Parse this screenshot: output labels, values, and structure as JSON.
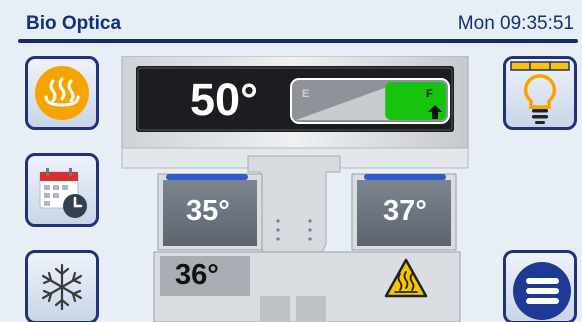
{
  "header": {
    "brand": "Bio Optica",
    "datetime": "Mon 09:35:51",
    "accent_color": "#13307a"
  },
  "sidebar_left": [
    {
      "icon": "heat-waves-icon"
    },
    {
      "icon": "calendar-clock-icon"
    },
    {
      "icon": "snowflake-icon"
    }
  ],
  "sidebar_right": [
    {
      "icon": "lightbulb-icon"
    },
    {
      "icon": "menu-icon"
    }
  ],
  "instrument": {
    "main_temp": "50°",
    "left_tank_temp": "35°",
    "right_tank_temp": "37°",
    "bottom_tank_temp": "36°",
    "level_gauge": {
      "empty_label": "E",
      "full_label": "F",
      "fill_fraction": 0.4,
      "fill_color": "#16c40f"
    },
    "warning_icon": "hot-surface-warning-icon"
  }
}
